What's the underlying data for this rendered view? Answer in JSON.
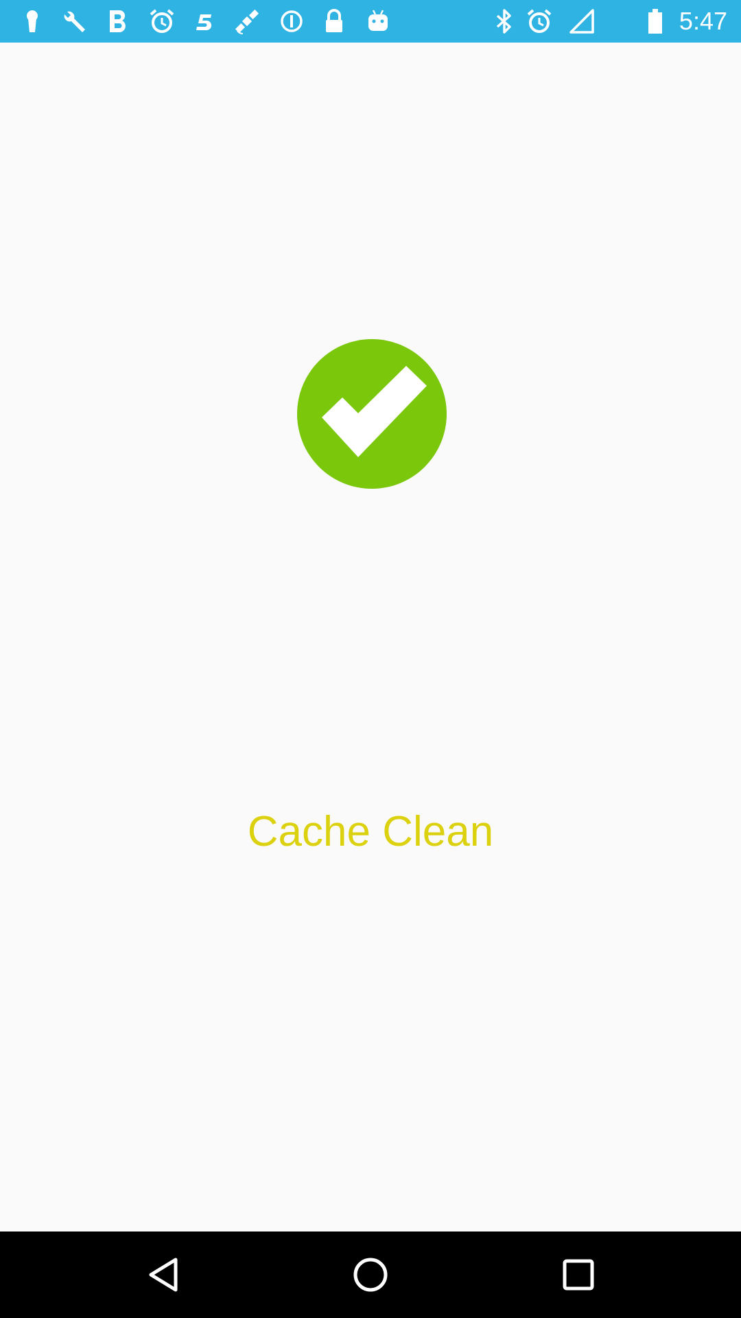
{
  "status_bar": {
    "time": "5:47",
    "background": "#2fb3e3",
    "left_icons": [
      "keyhole-icon",
      "wrench-icon",
      "bold-b-icon",
      "alarm-icon",
      "five-icon",
      "fake-gps-satellite-icon",
      "info-circle-icon",
      "lock-icon",
      "android-icon"
    ],
    "right_icons": [
      "bluetooth-icon",
      "alarm-icon",
      "signal-icon",
      "battery-icon"
    ]
  },
  "main": {
    "status_icon": "check-circle-icon",
    "status_color": "#7ac70c",
    "message": "Cache Clean",
    "message_color": "#dcd10f"
  },
  "nav_bar": {
    "buttons": [
      "back-icon",
      "home-icon",
      "recents-icon"
    ]
  }
}
